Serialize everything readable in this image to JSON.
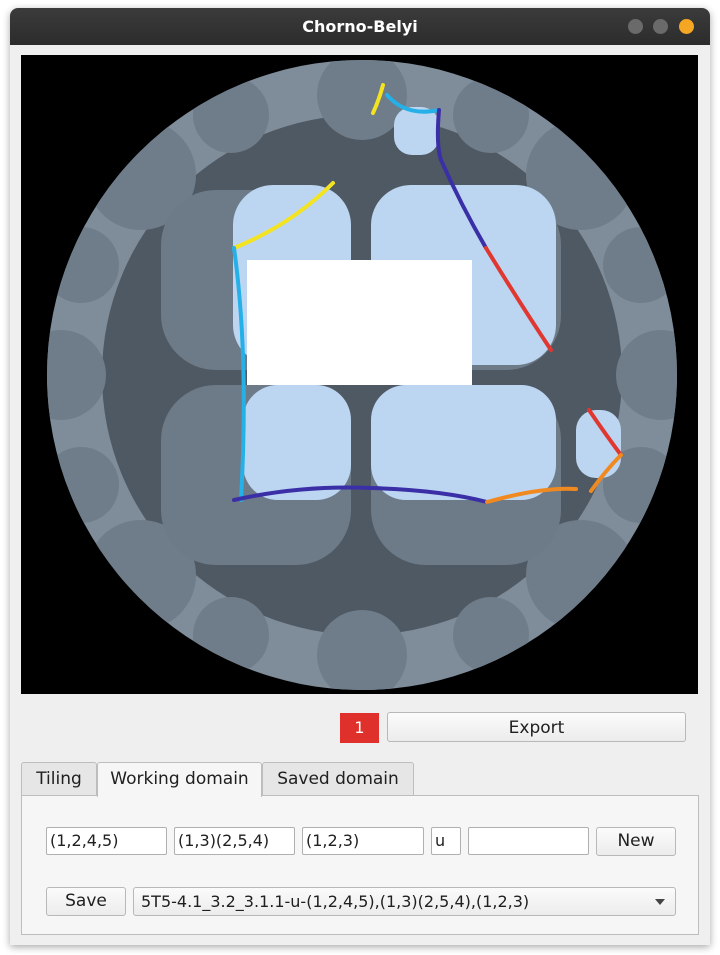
{
  "window": {
    "title": "Chorno-Belyi",
    "controls": [
      "minimize",
      "maximize",
      "close"
    ],
    "close_color": "#f5a623"
  },
  "canvas": {
    "background": "#000000",
    "disk_color": "#75828f",
    "domain_fill": "#b8d4f0",
    "edge_colors": [
      "#f4e320",
      "#25b0e8",
      "#3a2fa6",
      "#e03830",
      "#f08a20"
    ]
  },
  "toolbar": {
    "counter": "1",
    "counter_color": "#e0302c",
    "export_label": "Export"
  },
  "tabs": [
    {
      "label": "Tiling",
      "active": false
    },
    {
      "label": "Working domain",
      "active": true
    },
    {
      "label": "Saved domain",
      "active": false
    }
  ],
  "working_domain": {
    "sigma0": "(1,2,4,5)",
    "sigma1": "(1,3)(2,5,4)",
    "sigma_inf": "(1,2,3)",
    "symmetry": "u",
    "name": "",
    "new_label": "New",
    "save_label": "Save",
    "selected_domain": "5T5-4.1_3.2_3.1.1-u-(1,2,4,5),(1,3)(2,5,4),(1,2,3)"
  }
}
